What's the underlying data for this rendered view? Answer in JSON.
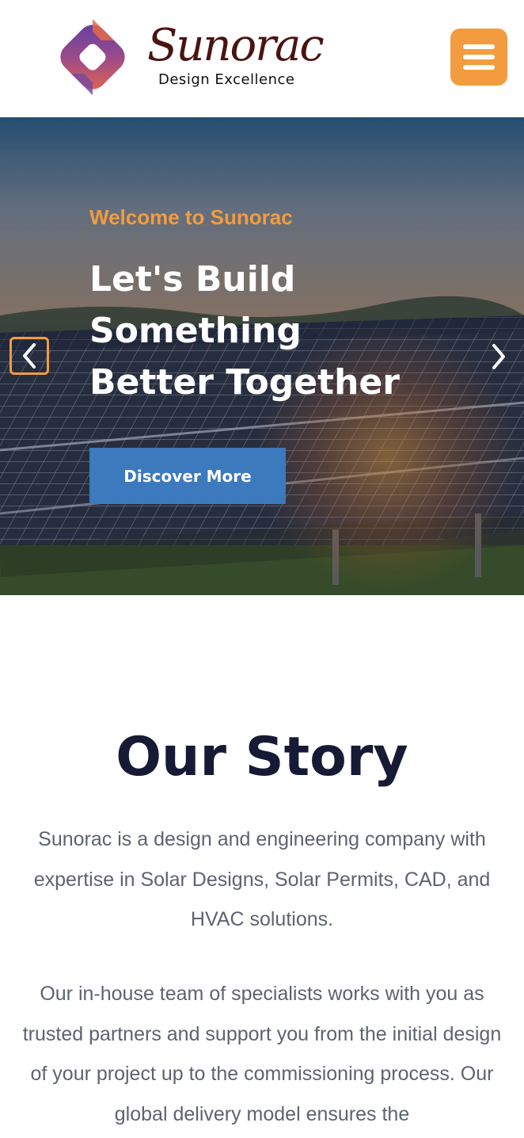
{
  "header": {
    "brand_name": "Sunorac",
    "brand_tagline": "Design Excellence",
    "menu_icon": "hamburger-menu-icon",
    "menu_color": "#f39c3f"
  },
  "hero": {
    "eyebrow": "Welcome to Sunorac",
    "title": "Let's Build Something Better Together",
    "cta_label": "Discover More",
    "prev_icon": "chevron-left-icon",
    "next_icon": "chevron-right-icon",
    "accent_color": "#f39c3f",
    "cta_color": "#3d79bd"
  },
  "story": {
    "title": "Our Story",
    "paragraph_1": "Sunorac is a design and engineering company with expertise in Solar Designs, Solar Permits, CAD, and HVAC solutions.",
    "paragraph_2": "Our in-house team of specialists works with you as trusted partners and support you from the initial design of your project up to the commissioning process. Our global delivery model ensures the"
  }
}
